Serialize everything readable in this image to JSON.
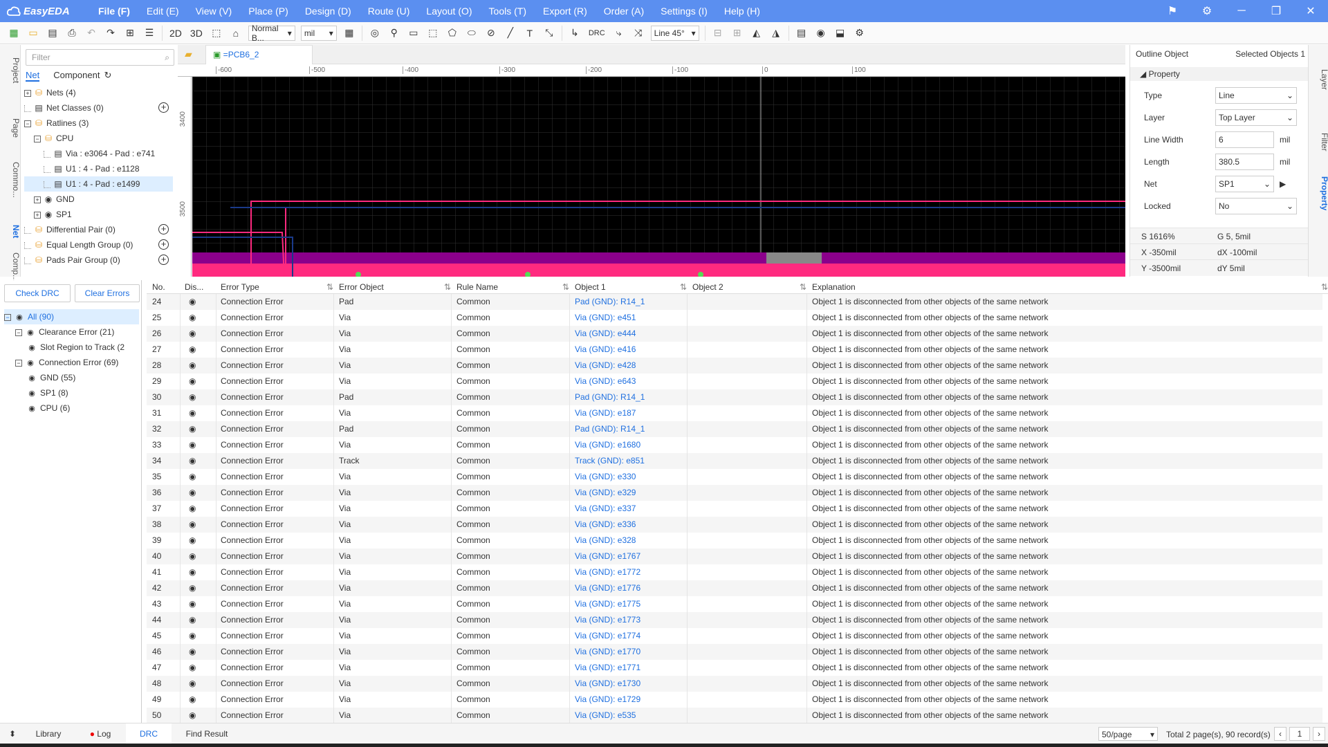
{
  "app": {
    "name": "EasyEDA"
  },
  "menu": [
    "File (F)",
    "Edit (E)",
    "View (V)",
    "Place (P)",
    "Design (D)",
    "Route (U)",
    "Layout (O)",
    "Tools (T)",
    "Export (R)",
    "Order (A)",
    "Settings (I)",
    "Help (H)"
  ],
  "toolbar": {
    "view2d": "2D",
    "view3d": "3D",
    "route_mode": "Normal B...",
    "unit": "mil",
    "drc": "DRC",
    "line_angle": "Line 45°"
  },
  "left": {
    "vtabs": [
      "Project",
      "Page",
      "Commo...",
      "Net",
      "Comp..."
    ],
    "filter_placeholder": "Filter",
    "tabs": [
      "Net",
      "Component"
    ],
    "tree": [
      {
        "label": "Nets (4)",
        "indent": 0,
        "expander": "+"
      },
      {
        "label": "Net Classes (0)",
        "indent": 0,
        "expander": ""
      },
      {
        "label": "Ratlines (3)",
        "indent": 0,
        "expander": "-"
      },
      {
        "label": "CPU",
        "indent": 1,
        "expander": "-"
      },
      {
        "label": "Via : e3064 - Pad : e741",
        "indent": 2,
        "expander": ""
      },
      {
        "label": "U1 : 4 - Pad : e1128",
        "indent": 2,
        "expander": ""
      },
      {
        "label": "U1 : 4 - Pad : e1499",
        "indent": 2,
        "expander": ""
      },
      {
        "label": "GND",
        "indent": 1,
        "expander": "+"
      },
      {
        "label": "SP1",
        "indent": 1,
        "expander": "+"
      },
      {
        "label": "Differential Pair (0)",
        "indent": 0,
        "expander": ""
      },
      {
        "label": "Equal Length Group (0)",
        "indent": 0,
        "expander": ""
      },
      {
        "label": "Pads Pair Group (0)",
        "indent": 0,
        "expander": ""
      }
    ]
  },
  "doc": {
    "tab": "PCB6_2"
  },
  "rulers": {
    "top": [
      "-600",
      "-500",
      "-400",
      "-300",
      "-200",
      "-100",
      "0",
      "100"
    ],
    "left": [
      "3400",
      "3500"
    ]
  },
  "right": {
    "title": "Outline Object",
    "selected": "Selected Objects",
    "selected_count": "1",
    "section": "Property",
    "vtabs": [
      "Layer",
      "Filter",
      "Property"
    ],
    "props": [
      {
        "label": "Type",
        "value": "Line",
        "kind": "select",
        "unit": ""
      },
      {
        "label": "Layer",
        "value": "Top Layer",
        "kind": "select",
        "unit": ""
      },
      {
        "label": "Line Width",
        "value": "6",
        "kind": "input",
        "unit": "mil"
      },
      {
        "label": "Length",
        "value": "380.5",
        "kind": "input",
        "unit": "mil"
      },
      {
        "label": "Net",
        "value": "SP1",
        "kind": "select",
        "unit": ""
      },
      {
        "label": "Locked",
        "value": "No",
        "kind": "select",
        "unit": ""
      }
    ],
    "status": {
      "s": "S 1616%",
      "g": "G 5, 5mil",
      "x": "X -350mil",
      "dx": "dX -100mil",
      "y": "Y -3500mil",
      "dy": "dY 5mil"
    }
  },
  "drc": {
    "check_label": "Check DRC",
    "clear_label": "Clear Errors",
    "tree": [
      {
        "label": "All (90)",
        "indent": 0
      },
      {
        "label": "Clearance Error (21)",
        "indent": 1
      },
      {
        "label": "Slot Region to Track (2",
        "indent": 2
      },
      {
        "label": "Connection Error (69)",
        "indent": 1
      },
      {
        "label": "GND (55)",
        "indent": 2
      },
      {
        "label": "SP1 (8)",
        "indent": 2
      },
      {
        "label": "CPU (6)",
        "indent": 2
      }
    ],
    "columns": [
      "No.",
      "Dis...",
      "Error Type",
      "Error Object",
      "Rule Name",
      "Object 1",
      "Object 2",
      "Explanation"
    ],
    "explanation": "Object 1 is disconnected from other objects of the same network",
    "rows": [
      [
        "24",
        "Connection Error",
        "Pad",
        "Common",
        "Pad (GND): R14_1"
      ],
      [
        "25",
        "Connection Error",
        "Via",
        "Common",
        "Via (GND): e451"
      ],
      [
        "26",
        "Connection Error",
        "Via",
        "Common",
        "Via (GND): e444"
      ],
      [
        "27",
        "Connection Error",
        "Via",
        "Common",
        "Via (GND): e416"
      ],
      [
        "28",
        "Connection Error",
        "Via",
        "Common",
        "Via (GND): e428"
      ],
      [
        "29",
        "Connection Error",
        "Via",
        "Common",
        "Via (GND): e643"
      ],
      [
        "30",
        "Connection Error",
        "Pad",
        "Common",
        "Pad (GND): R14_1"
      ],
      [
        "31",
        "Connection Error",
        "Via",
        "Common",
        "Via (GND): e187"
      ],
      [
        "32",
        "Connection Error",
        "Pad",
        "Common",
        "Pad (GND): R14_1"
      ],
      [
        "33",
        "Connection Error",
        "Via",
        "Common",
        "Via (GND): e1680"
      ],
      [
        "34",
        "Connection Error",
        "Track",
        "Common",
        "Track (GND): e851"
      ],
      [
        "35",
        "Connection Error",
        "Via",
        "Common",
        "Via (GND): e330"
      ],
      [
        "36",
        "Connection Error",
        "Via",
        "Common",
        "Via (GND): e329"
      ],
      [
        "37",
        "Connection Error",
        "Via",
        "Common",
        "Via (GND): e337"
      ],
      [
        "38",
        "Connection Error",
        "Via",
        "Common",
        "Via (GND): e336"
      ],
      [
        "39",
        "Connection Error",
        "Via",
        "Common",
        "Via (GND): e328"
      ],
      [
        "40",
        "Connection Error",
        "Via",
        "Common",
        "Via (GND): e1767"
      ],
      [
        "41",
        "Connection Error",
        "Via",
        "Common",
        "Via (GND): e1772"
      ],
      [
        "42",
        "Connection Error",
        "Via",
        "Common",
        "Via (GND): e1776"
      ],
      [
        "43",
        "Connection Error",
        "Via",
        "Common",
        "Via (GND): e1775"
      ],
      [
        "44",
        "Connection Error",
        "Via",
        "Common",
        "Via (GND): e1773"
      ],
      [
        "45",
        "Connection Error",
        "Via",
        "Common",
        "Via (GND): e1774"
      ],
      [
        "46",
        "Connection Error",
        "Via",
        "Common",
        "Via (GND): e1770"
      ],
      [
        "47",
        "Connection Error",
        "Via",
        "Common",
        "Via (GND): e1771"
      ],
      [
        "48",
        "Connection Error",
        "Via",
        "Common",
        "Via (GND): e1730"
      ],
      [
        "49",
        "Connection Error",
        "Via",
        "Common",
        "Via (GND): e1729"
      ],
      [
        "50",
        "Connection Error",
        "Via",
        "Common",
        "Via (GND): e535"
      ]
    ]
  },
  "bottom": {
    "tabs": [
      "Library",
      "Log",
      "DRC",
      "Find Result"
    ],
    "page_size": "50/page",
    "total": "Total 2 page(s), 90 record(s)",
    "page": "1"
  },
  "colors": {
    "accent": "#5b8ff0",
    "link": "#1e6fe0",
    "pcb_board": "#8b008b",
    "pcb_track": "#ff2a7f"
  }
}
